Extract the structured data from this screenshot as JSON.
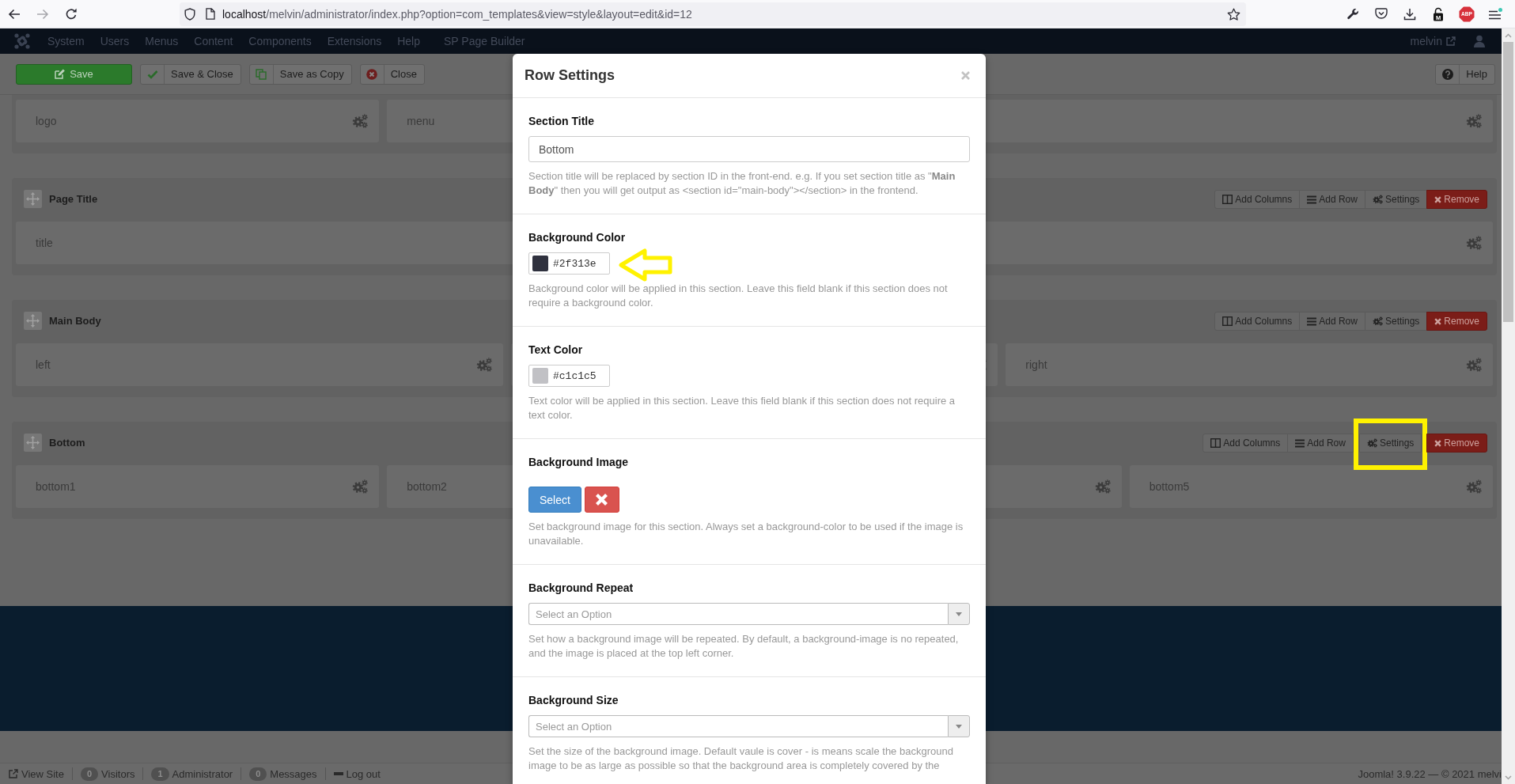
{
  "browser": {
    "address": {
      "host": "localhost",
      "path": "/melvin/administrator/index.php?option=com_templates&view=style&layout=edit&id=12"
    },
    "extensions": [
      {
        "kind": "lock",
        "label": "M"
      },
      {
        "kind": "abp",
        "label": "ABP"
      }
    ]
  },
  "navbar": {
    "menu": [
      "System",
      "Users",
      "Menus",
      "Content",
      "Components",
      "Extensions",
      "Help",
      "SP Page Builder"
    ],
    "user": "melvin"
  },
  "toolbar": {
    "buttons": [
      {
        "kind": "save",
        "label": "Save"
      },
      {
        "kind": "check",
        "label": "Save & Close"
      },
      {
        "kind": "copy",
        "label": "Save as Copy"
      },
      {
        "kind": "close",
        "label": "Close"
      }
    ],
    "help": "Help"
  },
  "sections": [
    {
      "columns": [
        "logo",
        "menu"
      ]
    },
    {
      "title": "Page Title",
      "actions": [
        {
          "kind": "columns",
          "label": "Add Columns",
          "highlighted": false
        },
        {
          "kind": "row",
          "label": "Add Row",
          "highlighted": false
        },
        {
          "kind": "settings",
          "label": "Settings",
          "highlighted": false
        },
        {
          "kind": "remove",
          "label": "Remove",
          "highlighted": false
        }
      ],
      "columns": [
        "title"
      ]
    },
    {
      "title": "Main Body",
      "actions": [
        {
          "kind": "columns",
          "label": "Add Columns",
          "highlighted": false
        },
        {
          "kind": "row",
          "label": "Add Row",
          "highlighted": false
        },
        {
          "kind": "settings",
          "label": "Settings",
          "highlighted": false
        },
        {
          "kind": "remove",
          "label": "Remove",
          "highlighted": false
        }
      ],
      "columns": [
        "left",
        "right"
      ]
    },
    {
      "title": "Bottom",
      "actions": [
        {
          "kind": "columns",
          "label": "Add Columns",
          "highlighted": false
        },
        {
          "kind": "row",
          "label": "Add Row",
          "highlighted": false
        },
        {
          "kind": "settings",
          "label": "Settings",
          "highlighted": true
        },
        {
          "kind": "remove",
          "label": "Remove",
          "highlighted": false
        }
      ],
      "columns": [
        "bottom1",
        "bottom2",
        "bottom5"
      ]
    }
  ],
  "status_bar": {
    "items": [
      {
        "kind": "view",
        "label": "View Site"
      },
      {
        "kind": "count",
        "count": "0",
        "label": "Visitors"
      },
      {
        "kind": "count",
        "count": "1",
        "label": "Administrator"
      },
      {
        "kind": "count",
        "count": "0",
        "label": "Messages"
      },
      {
        "kind": "logout",
        "label": "Log out"
      }
    ],
    "version": "Joomla! 3.9.22 — © 2021 melvi"
  },
  "modal": {
    "title": "Row Settings",
    "fields": [
      {
        "kind": "text",
        "label": "Section Title",
        "value": "Bottom",
        "help": "Section title will be replaced by section ID in the front-end. e.g. If you set section title as \"**Main Body**\" then you will get output as <section id=\"main-body\"></section> in the frontend.",
        "highlighted": false
      },
      {
        "kind": "color",
        "label": "Background Color",
        "value": "#2f313e",
        "color": "#2f313e",
        "help": "Background color will be applied in this section. Leave this field blank if this section does not require a background color.",
        "highlighted": true
      },
      {
        "kind": "color",
        "label": "Text Color",
        "value": "#c1c1c5",
        "color": "#c1c1c5",
        "help": "Text color will be applied in this section. Leave this field blank if this section does not require a text color.",
        "highlighted": false
      },
      {
        "kind": "image",
        "label": "Background Image",
        "button": "Select",
        "help": "Set background image for this section. Always set a background-color to be used if the image is unavailable.",
        "highlighted": false
      },
      {
        "kind": "select",
        "label": "Background Repeat",
        "placeholder": "Select an Option",
        "help": "Set how a background image will be repeated. By default, a background-image is no repeated, and the image is placed at the top left corner.",
        "highlighted": false
      },
      {
        "kind": "select",
        "label": "Background Size",
        "placeholder": "Select an Option",
        "help": "Set the size of the background image. Default vaule is cover - is means scale the background image to be as large as possible so that the background area is completely covered by the",
        "highlighted": false
      }
    ]
  }
}
